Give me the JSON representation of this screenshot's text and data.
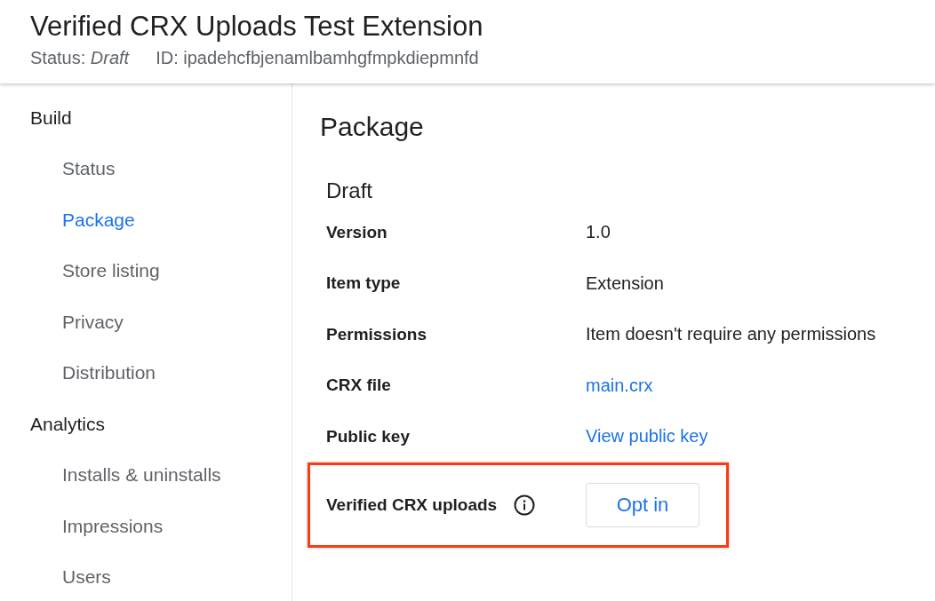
{
  "header": {
    "title": "Verified CRX Uploads Test Extension",
    "status": "Status: *Draft*",
    "id_text": "ID: ipadehcfbjenamlbamhgfmpkdiepmnfd"
  },
  "sidebar": {
    "sections": [
      {
        "title": "Build",
        "items": [
          {
            "label": "Status",
            "selected": false
          },
          {
            "label": "Package",
            "selected": true
          },
          {
            "label": "Store listing",
            "selected": false
          },
          {
            "label": "Privacy",
            "selected": false
          },
          {
            "label": "Distribution",
            "selected": false
          }
        ]
      },
      {
        "title": "Analytics",
        "items": [
          {
            "label": "Installs & uninstalls",
            "selected": false
          },
          {
            "label": "Impressions",
            "selected": false
          },
          {
            "label": "Users",
            "selected": false
          }
        ]
      }
    ]
  },
  "main": {
    "heading": "Package",
    "subheading": "Draft",
    "rows": [
      {
        "label": "Version",
        "kind": "text",
        "value": "1.0",
        "info": false,
        "highlighted": false
      },
      {
        "label": "Item type",
        "kind": "text",
        "value": "Extension",
        "info": false,
        "highlighted": false
      },
      {
        "label": "Permissions",
        "kind": "text",
        "value": "Item doesn't require any permissions",
        "info": false,
        "highlighted": false
      },
      {
        "label": "CRX file",
        "kind": "link",
        "value": "main.crx",
        "info": false,
        "highlighted": false
      },
      {
        "label": "Public key",
        "kind": "link",
        "value": "View public key",
        "info": false,
        "highlighted": false
      },
      {
        "label": "Verified CRX uploads",
        "kind": "button",
        "value": "Opt in",
        "info": true,
        "highlighted": true
      }
    ]
  }
}
